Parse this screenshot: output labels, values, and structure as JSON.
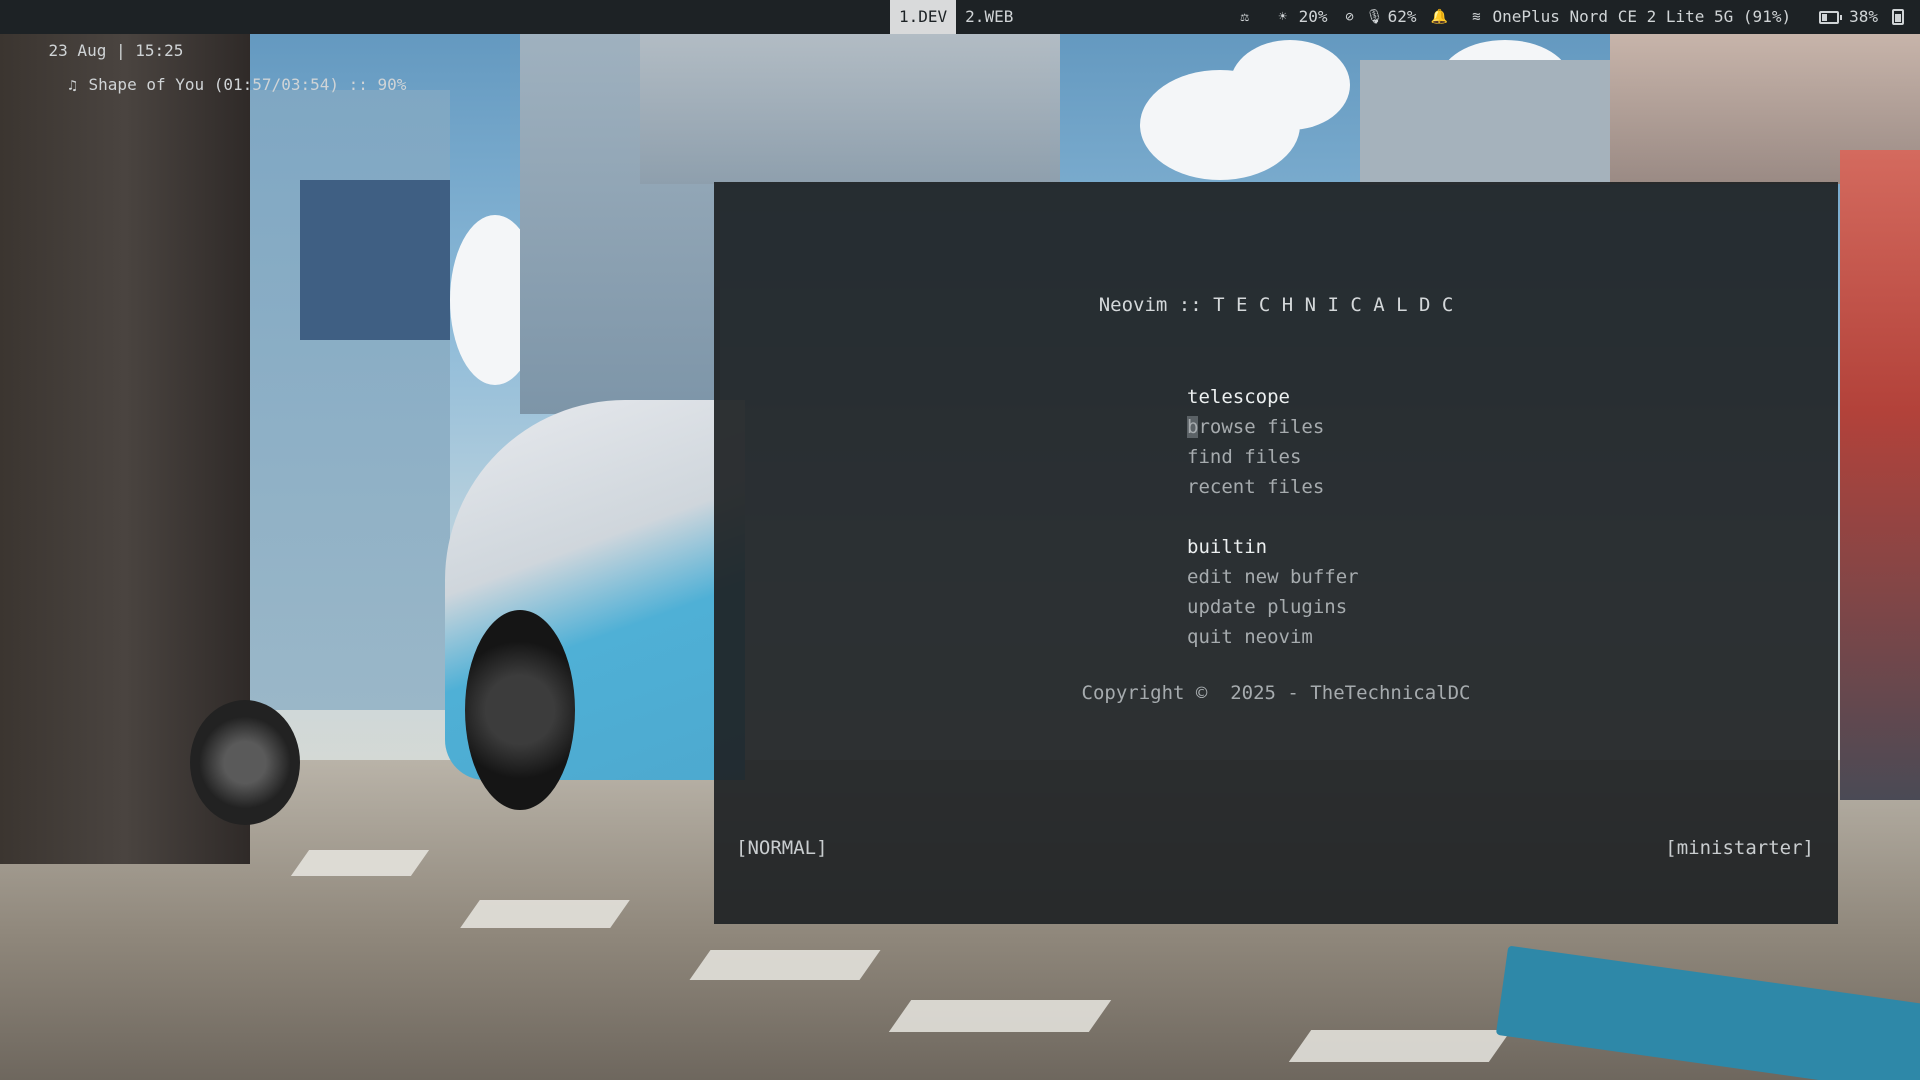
{
  "topbar": {
    "datetime": "23 Aug | 15:25",
    "music_icon": "music-note-icon",
    "now_playing": "Shape of You (01:57/03:54) :: 90%",
    "workspaces": [
      {
        "label": "1.DEV",
        "active": true
      },
      {
        "label": "2.WEB",
        "active": false
      }
    ],
    "status": {
      "balance_icon": "scale-icon",
      "brightness_icon": "brightness-icon",
      "brightness": "20%",
      "mic_muted_icon": "mic-muted-icon",
      "mic_icon": "mic-icon",
      "volume": "62%",
      "bell_icon": "bell-icon",
      "wifi_icon": "wifi-icon",
      "network": "OnePlus Nord CE 2 Lite 5G (91%)",
      "battery_icon": "battery-icon",
      "battery": "38%",
      "battery_level": 0.38,
      "phone_icon": "phone-battery-icon"
    }
  },
  "nvim": {
    "header": "Neovim :: T E C H N I C A L D C",
    "sections": [
      {
        "title": "telescope",
        "items": [
          "browse files",
          "find files",
          "recent files"
        ]
      },
      {
        "title": "builtin",
        "items": [
          "edit new buffer",
          "update plugins",
          "quit neovim"
        ]
      }
    ],
    "footer": "Copyright ©  2025 - TheTechnicalDC",
    "mode": "[NORMAL]",
    "plugin": "[ministarter]"
  },
  "colors": {
    "bar_bg": "#1d2225",
    "window_bg": "#1e2224",
    "active_workspace_bg": "#d9dadb"
  }
}
